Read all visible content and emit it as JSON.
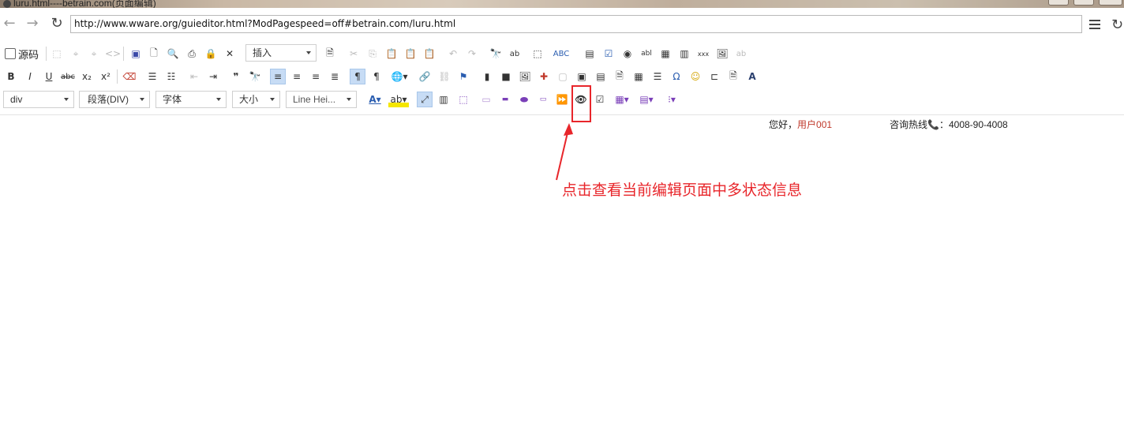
{
  "window": {
    "title": "luru.html----betrain.com(页面编辑)"
  },
  "browser": {
    "url": "http://www.wware.org/guieditor.html?ModPagespeed=off#betrain.com/luru.html"
  },
  "toolbar1": {
    "source_label": "源码",
    "insert_label": "插入"
  },
  "toolbar3": {
    "element_combo": "div",
    "format_combo": "段落(DIV)",
    "font_combo": "字体",
    "size_combo": "大小",
    "lineheight_combo": "Line Hei..."
  },
  "header": {
    "greeting": "您好，",
    "username": "用户001",
    "hotline_label": "咨询热线",
    "hotline_phone_icon": "📞",
    "hotline_number": "：4008-90-4008"
  },
  "annotation": {
    "note": "点击查看当前编辑页面中多状态信息",
    "color": "#e8262b"
  },
  "colors": {
    "selected_button_bg": "#c7dcf5",
    "user_name": "#c0392b"
  }
}
